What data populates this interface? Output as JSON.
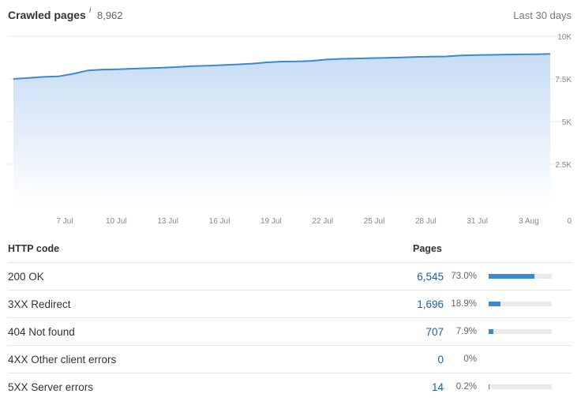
{
  "header": {
    "title": "Crawled pages",
    "info_icon": "i",
    "count": "8,962",
    "range": "Last 30 days"
  },
  "colors": {
    "line": "#3a8ad3",
    "fill_top": "#c7dcf4",
    "fill_bottom": "#ffffff",
    "grid": "#e8e8e8",
    "link": "#1d5fa8",
    "bar_track": "#eaeaea"
  },
  "chart_data": {
    "type": "area",
    "title": "",
    "xlabel": "",
    "ylabel": "",
    "x_ticks": [
      "7 Jul",
      "10 Jul",
      "13 Jul",
      "16 Jul",
      "19 Jul",
      "22 Jul",
      "25 Jul",
      "28 Jul",
      "31 Jul",
      "3 Aug"
    ],
    "y_ticks": [
      "0",
      "2.5K",
      "5K",
      "7.5K",
      "10K"
    ],
    "ylim": [
      0,
      10000
    ],
    "y_axis_position": "right",
    "grid": true,
    "series": [
      {
        "values": [
          7500,
          7560,
          7620,
          7650,
          7800,
          8000,
          8050,
          8070,
          8100,
          8130,
          8160,
          8200,
          8250,
          8280,
          8310,
          8350,
          8400,
          8470,
          8520,
          8530,
          8560,
          8640,
          8680,
          8700,
          8720,
          8740,
          8760,
          8790,
          8810,
          8820,
          8880,
          8900,
          8910,
          8930,
          8940,
          8950,
          8970
        ]
      }
    ]
  },
  "table": {
    "col_code": "HTTP code",
    "col_pages": "Pages",
    "rows": [
      {
        "label": "200 OK",
        "count": "6,545",
        "pct": "73.0%",
        "fraction": 0.73
      },
      {
        "label": "3XX Redirect",
        "count": "1,696",
        "pct": "18.9%",
        "fraction": 0.189
      },
      {
        "label": "404 Not found",
        "count": "707",
        "pct": "7.9%",
        "fraction": 0.079
      },
      {
        "label": "4XX Other client errors",
        "count": "0",
        "pct": "0%",
        "fraction": null
      },
      {
        "label": "5XX Server errors",
        "count": "14",
        "pct": "0.2%",
        "fraction": 0.002
      }
    ]
  }
}
